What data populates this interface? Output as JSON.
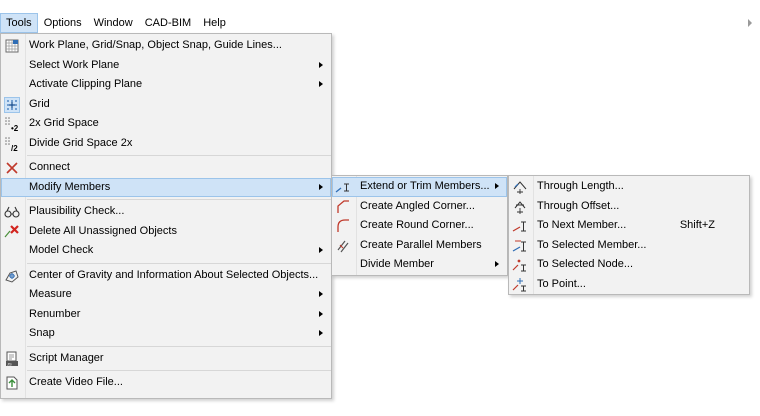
{
  "menubar": {
    "items": [
      "Tools",
      "Options",
      "Window",
      "CAD-BIM",
      "Help"
    ]
  },
  "tools_menu": {
    "work_plane": "Work Plane, Grid/Snap, Object Snap, Guide Lines...",
    "select_work_plane": "Select Work Plane",
    "activate_clipping_plane": "Activate Clipping Plane",
    "grid": "Grid",
    "grid_space_2x": "2x Grid Space",
    "divide_grid_space": "Divide Grid Space 2x",
    "connect": "Connect",
    "modify_members": "Modify Members",
    "plausibility_check": "Plausibility Check...",
    "delete_unassigned": "Delete All Unassigned Objects",
    "model_check": "Model Check",
    "center_of_gravity": "Center of Gravity and Information About Selected Objects...",
    "measure": "Measure",
    "renumber": "Renumber",
    "snap": "Snap",
    "script_manager": "Script Manager",
    "create_video": "Create Video File..."
  },
  "modify_members_menu": {
    "extend_trim": "Extend or Trim Members...",
    "angled_corner": "Create Angled Corner...",
    "round_corner": "Create Round Corner...",
    "parallel_members": "Create Parallel Members",
    "divide_member": "Divide Member"
  },
  "extend_menu": {
    "through_length": "Through Length...",
    "through_offset": "Through Offset...",
    "to_next_member": "To Next Member...",
    "to_next_member_shortcut": "Shift+Z",
    "to_selected_member": "To Selected Member...",
    "to_selected_node": "To Selected Node...",
    "to_point": "To Point..."
  },
  "colors": {
    "highlight": "#cfe3f7",
    "highlight_border": "#9cc4ea",
    "menu_bg": "#f2f2f2",
    "icon_red": "#c0392b",
    "icon_blue": "#2f6db5"
  }
}
